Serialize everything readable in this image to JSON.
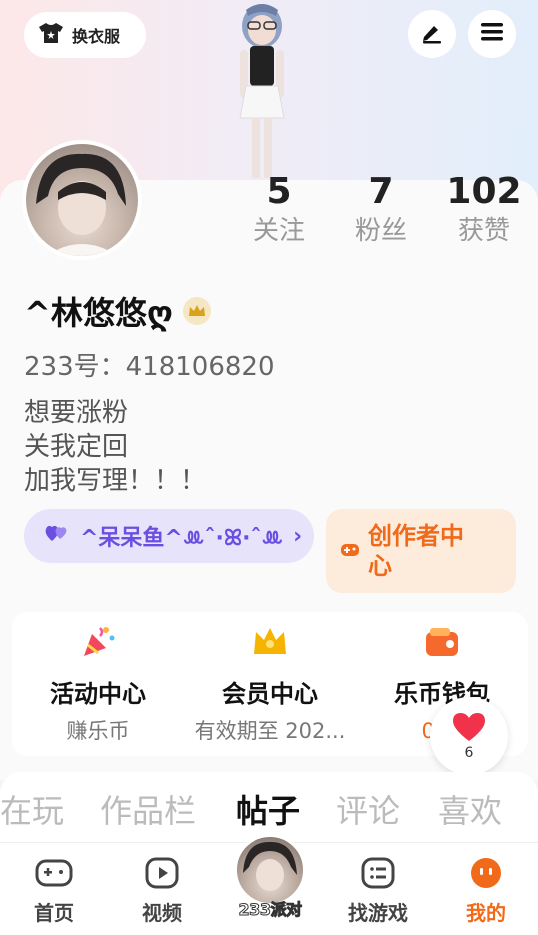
{
  "header": {
    "wardrobe_label": "换衣服",
    "icons": [
      "tshirt-icon",
      "edit-icon",
      "menu-icon"
    ]
  },
  "stats": [
    {
      "value": "5",
      "label": "关注"
    },
    {
      "value": "7",
      "label": "粉丝"
    },
    {
      "value": "102",
      "label": "获赞"
    }
  ],
  "profile": {
    "name": "^林悠悠ღ",
    "uid": "233号：418106820",
    "bio": [
      "想要涨粉",
      "关我定回",
      "加我写理！！！"
    ]
  },
  "chips": {
    "guild_label": "^呆呆鱼^ꔛˆ·ꕤ·ˆꔛ",
    "creator_label": "创作者中心"
  },
  "features": [
    {
      "title": "活动中心",
      "sub": "赚乐币",
      "icon": "party-popper-icon"
    },
    {
      "title": "会员中心",
      "sub": "有效期至 202...",
      "icon": "crown-icon"
    },
    {
      "title": "乐币钱包",
      "sub": "0 乐",
      "icon": "wallet-icon"
    }
  ],
  "favorite": {
    "count": "6"
  },
  "tabs": [
    "在玩",
    "作品栏",
    "帖子",
    "评论",
    "喜欢"
  ],
  "active_tab": "帖子",
  "nav": {
    "home": "首页",
    "video": "视频",
    "party": "233派对",
    "games": "找游戏",
    "mine": "我的"
  },
  "colors": {
    "accent": "#f06a1a",
    "guild_purple": "#6b4fe0",
    "heart_red": "#f0334b",
    "crown_gold": "#f5b400"
  }
}
